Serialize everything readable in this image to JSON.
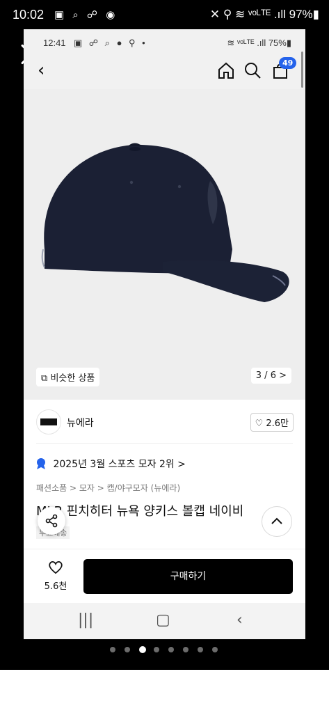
{
  "outer_status": {
    "time": "10:02",
    "icons": "▣ ⌕ ☍ ◉",
    "right": "✕ ⚲ ≋ ᵛᵒᴸᵀᴱ .ıll 97%▮"
  },
  "inner_status": {
    "time": "12:41",
    "icons": "▣ ☍ ⌕ ● ⚲ •",
    "right": "≋ ᵛᵒᴸᵀᴱ .ıll 75%▮"
  },
  "header": {
    "cart_count": "49"
  },
  "image": {
    "similar_label": "비슷한 상품",
    "page_indicator": "3 / 6 >"
  },
  "brand": {
    "name": "뉴에라",
    "logo_text": "NEW ERA",
    "likes": "2.6만"
  },
  "rank_text": "2025년 3월 스포츠 모자 2위 >",
  "breadcrumb": "패션소품 > 모자 > 캡/야구모자 (뉴에라)",
  "product_title": "MLB 핀치히터 뉴욕 양키스 볼캡 네이비",
  "delivery_tag": "무료배송",
  "bottom": {
    "fav_count": "5.6천",
    "buy_label": "구매하기"
  },
  "pager": {
    "total": 8,
    "active": 2
  },
  "colors": {
    "accent": "#2563eb",
    "buy": "#000000",
    "cap": "#1b2034"
  }
}
